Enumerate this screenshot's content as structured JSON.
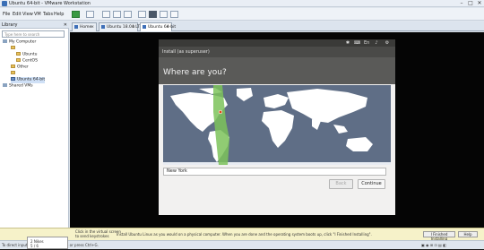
{
  "window": {
    "title": "Ubuntu 64-bit - VMware Workstation",
    "minimize": "–",
    "maximize": "□",
    "close": "✕"
  },
  "menu": [
    "File",
    "Edit",
    "View",
    "VM",
    "Tabs",
    "Help"
  ],
  "library": {
    "title": "Library",
    "close": "✕",
    "search_placeholder": "Type here to search",
    "tree": [
      {
        "label": "My Computer",
        "type": "pc"
      },
      {
        "label": "",
        "type": "folder"
      },
      {
        "label": "Ubuntu",
        "type": "folder"
      },
      {
        "label": "CentOS",
        "type": "folder"
      },
      {
        "label": "Other",
        "type": "folder"
      },
      {
        "label": "",
        "type": "folder"
      },
      {
        "label": "Ubuntu 64-bit",
        "type": "vm"
      },
      {
        "label": "Shared VMs",
        "type": "pc"
      }
    ]
  },
  "tabs": [
    {
      "label": "Home",
      "active": false
    },
    {
      "label": "Ubuntu 18.04 LTS",
      "active": false
    },
    {
      "label": "Ubuntu 64-bit",
      "active": true
    }
  ],
  "installer": {
    "window_title": "Install (as superuser)",
    "heading": "Where are you?",
    "city_value": "New York",
    "back_label": "Back",
    "continue_label": "Continue",
    "progress_dots": 8,
    "current_step": 6
  },
  "status": {
    "hint1": "Click in the virtual screen",
    "hint2": "to send keystrokes",
    "message": "Install Ubuntu Linux as you would on a physical computer. When you are done and the operating system boots up, click \"I Finished Installing\".",
    "finished_button": "I Finished Installing",
    "help_button": "Help",
    "bottom_left": "To direct input to this VM, click inside or press Ctrl+G.",
    "popup_line1": "2 Nikes",
    "popup_line2": "5 / 6"
  },
  "colors": {
    "accent": "#dd4814",
    "map_sea": "#5f6e86",
    "land": "#ffffff",
    "timezone": "#7cc35b"
  }
}
